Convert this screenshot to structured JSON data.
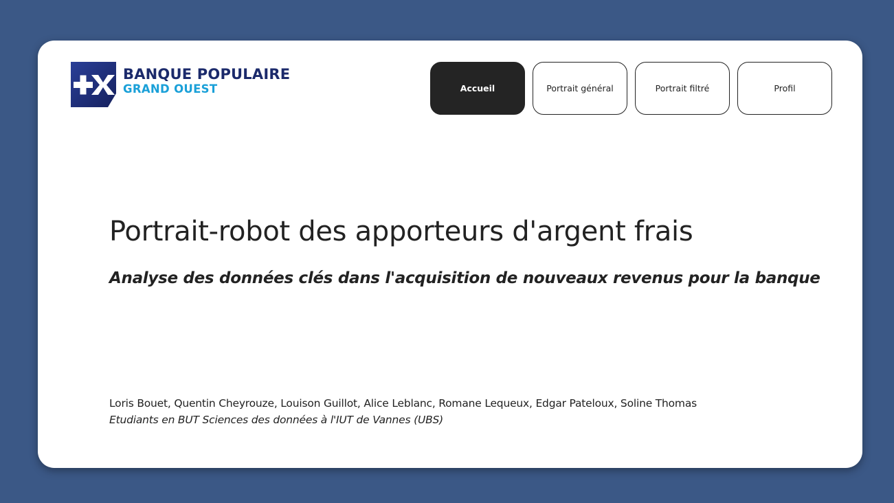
{
  "brand": {
    "line1": "BANQUE POPULAIRE",
    "line2": "GRAND OUEST",
    "logo_icon": "plus-x-logo-icon",
    "colors": {
      "navy": "#1b2a6b",
      "cyan": "#1aa0d8",
      "page_background": "#3b5886",
      "active_button": "#242424"
    }
  },
  "nav": {
    "items": [
      {
        "label": "Accueil",
        "active": true
      },
      {
        "label": "Portrait général",
        "active": false
      },
      {
        "label": "Portrait filtré",
        "active": false
      },
      {
        "label": "Profil",
        "active": false
      }
    ]
  },
  "hero": {
    "title": "Portrait-robot des apporteurs d'argent frais",
    "subtitle": "Analyse des données clés dans l'acquisition de nouveaux revenus pour la banque"
  },
  "credits": {
    "authors": "Loris Bouet, Quentin Cheyrouze, Louison Guillot, Alice Leblanc, Romane Lequeux, Edgar Pateloux, Soline Thomas",
    "affiliation": "Etudiants en BUT Sciences des données à l'IUT de Vannes (UBS)"
  }
}
